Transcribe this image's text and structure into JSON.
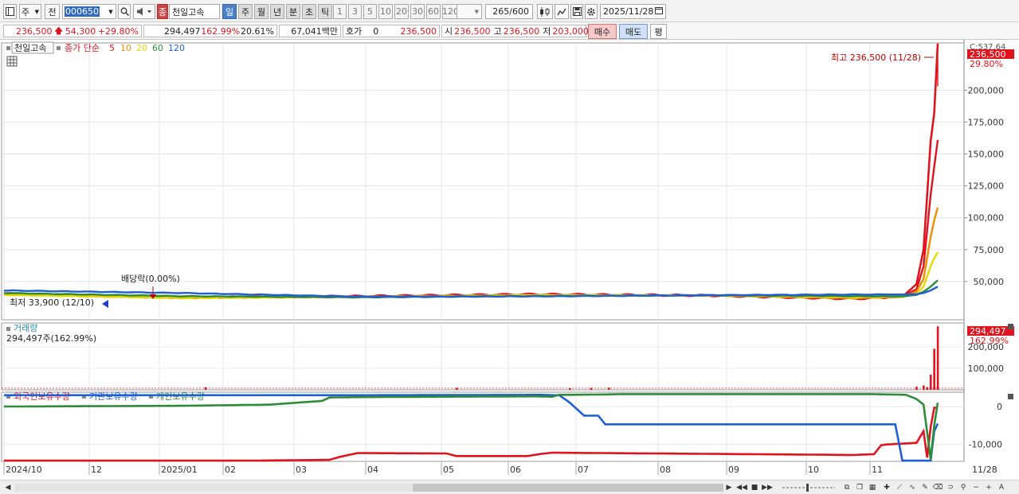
{
  "toolbar": {
    "period_select": "주",
    "prev_label": "전",
    "stock_code": "000650",
    "stock_type_badge": "종",
    "stock_name": "천일고속",
    "period_buttons": [
      "일",
      "주",
      "월",
      "년",
      "분",
      "초",
      "틱"
    ],
    "selected_period": "일",
    "minute_buttons": [
      "1",
      "3",
      "5",
      "10",
      "20",
      "30",
      "60",
      "120"
    ],
    "count_value": "265",
    "count_total": "/600",
    "date_value": "2025/11/28"
  },
  "info": {
    "price": "236,500",
    "change": "54,300",
    "change_pct": "+29.80%",
    "volume": "294,497",
    "volume_pct": "162.99%",
    "turnover": "20.61%",
    "amount": "67,041백만",
    "quote_label": "호가",
    "quote_value": "0",
    "ask_price": "236,500",
    "open_label": "시",
    "open": "236,500",
    "high_label": "고",
    "high": "236,500",
    "low_label": "저",
    "low": "203,000",
    "buy_label": "매수",
    "sell_label": "매도",
    "eval_label": "평"
  },
  "chart_data": [
    {
      "type": "line",
      "panel": "price",
      "legend_stock": "천일고속",
      "legend_items": [
        {
          "name": "종가 단순",
          "color": "#e0141e"
        },
        {
          "name": "5",
          "color": "#e0141e"
        },
        {
          "name": "10",
          "color": "#f08c00"
        },
        {
          "name": "20",
          "color": "#e6d800"
        },
        {
          "name": "60",
          "color": "#2e8b3a"
        },
        {
          "name": "120",
          "color": "#1f5fd6"
        }
      ],
      "x_ticks": [
        "2024/10",
        "12",
        "2025/01",
        "02",
        "03",
        "04",
        "05",
        "06",
        "07",
        "08",
        "09",
        "10",
        "11"
      ],
      "x_end_label": "11/28",
      "y_ticks": [
        50000,
        75000,
        100000,
        125000,
        150000,
        175000,
        200000
      ],
      "ylim": [
        20000,
        237000
      ],
      "grid": true,
      "current_price_tag": "236,500",
      "current_pct_tag": "29.80%",
      "top_right_label": "C:537.64",
      "annotations": {
        "high": "최고 236,500 (11/28)",
        "low": "최저 33,900 (12/10)",
        "dividend": "배당락(0.00%)"
      },
      "series": [
        {
          "name": "종가",
          "color": "#e0141e",
          "x": [
            0,
            50,
            100,
            150,
            200,
            240,
            254,
            258,
            260,
            262,
            263,
            264
          ],
          "values": [
            40500,
            37500,
            38500,
            40000,
            39000,
            36500,
            38000,
            48000,
            75000,
            160000,
            182000,
            236500
          ]
        },
        {
          "name": "5",
          "color": "#e0141e",
          "x": [
            0,
            50,
            100,
            150,
            200,
            240,
            254,
            258,
            260,
            262,
            263,
            264
          ],
          "values": [
            40000,
            37800,
            38300,
            39700,
            39000,
            36800,
            38000,
            44000,
            62000,
            118000,
            140000,
            161000
          ]
        },
        {
          "name": "10",
          "color": "#f08c00",
          "x": [
            0,
            50,
            100,
            150,
            200,
            240,
            254,
            258,
            260,
            262,
            263,
            264
          ],
          "values": [
            40000,
            38000,
            38200,
            39500,
            39000,
            37000,
            38000,
            42000,
            52000,
            85000,
            98000,
            108000
          ]
        },
        {
          "name": "20",
          "color": "#e6d800",
          "x": [
            0,
            50,
            100,
            150,
            200,
            240,
            254,
            258,
            260,
            262,
            263,
            264
          ],
          "values": [
            39500,
            37000,
            37900,
            39200,
            39200,
            37500,
            38000,
            40000,
            46000,
            62000,
            68000,
            73000
          ]
        },
        {
          "name": "60",
          "color": "#2e8b3a",
          "x": [
            0,
            50,
            100,
            150,
            200,
            240,
            254,
            258,
            260,
            262,
            263,
            264
          ],
          "values": [
            41000,
            38500,
            37600,
            38500,
            39200,
            38500,
            38300,
            39500,
            42000,
            46000,
            48500,
            51000
          ]
        },
        {
          "name": "120",
          "color": "#1f5fd6",
          "x": [
            0,
            50,
            100,
            150,
            200,
            240,
            254,
            258,
            260,
            262,
            263,
            264
          ],
          "values": [
            43000,
            41000,
            38200,
            38400,
            39300,
            39800,
            39800,
            40000,
            41000,
            43000,
            44500,
            46000
          ]
        }
      ]
    },
    {
      "type": "bar",
      "panel": "volume",
      "title": "거래량",
      "value_label": "294,497주(162.99%)",
      "current_tag": "294,497",
      "current_pct_tag": "162.99%",
      "y_ticks": [
        100000,
        200000
      ],
      "ylim": [
        0,
        310000
      ],
      "x": [
        57,
        128,
        160,
        166,
        171,
        258,
        260,
        261,
        262,
        263,
        264
      ],
      "values": [
        12000,
        9000,
        8000,
        9000,
        10000,
        14000,
        20000,
        12000,
        70000,
        190000,
        294497
      ],
      "color": "#e0141e"
    },
    {
      "type": "line",
      "panel": "holdings",
      "legend": [
        "외국인보유수량",
        "기관보유수량",
        "개인보유수량"
      ],
      "y_ticks": [
        0,
        -10000
      ],
      "ylim": [
        -14500,
        3800
      ],
      "grid": true,
      "series": [
        {
          "name": "외국인보유수량",
          "color": "#e0141e",
          "x": [
            0,
            25,
            46,
            70,
            92,
            95,
            100,
            125,
            128,
            148,
            152,
            155,
            240,
            246,
            248,
            250,
            256,
            258,
            260,
            261,
            262,
            263,
            264
          ],
          "values": [
            -14300,
            -14300,
            -14300,
            -14300,
            -14100,
            -13300,
            -12300,
            -12400,
            -13100,
            -13100,
            -12500,
            -12200,
            -12800,
            -12600,
            -10200,
            -10000,
            -9700,
            -9600,
            -6500,
            -13500,
            -5500,
            -300,
            -300
          ]
        },
        {
          "name": "기관보유수량",
          "color": "#1f5fd6",
          "x": [
            0,
            50,
            100,
            150,
            152,
            155,
            157,
            160,
            164,
            168,
            170,
            172,
            175,
            250,
            252,
            254,
            258,
            260,
            262,
            263,
            264
          ],
          "values": [
            3000,
            3000,
            3000,
            3100,
            3100,
            3000,
            3000,
            1000,
            -2400,
            -2400,
            -4700,
            -4700,
            -4700,
            -4700,
            -4700,
            -14300,
            -14300,
            -14300,
            -14300,
            -6500,
            -4500
          ]
        },
        {
          "name": "개인보유수량",
          "color": "#2e8b3a",
          "x": [
            0,
            50,
            75,
            90,
            92,
            100,
            125,
            150,
            155,
            157,
            160,
            170,
            175,
            200,
            245,
            255,
            258,
            260,
            262,
            263,
            264
          ],
          "values": [
            0,
            200,
            500,
            1500,
            2400,
            2500,
            2600,
            2700,
            2600,
            3100,
            3100,
            3200,
            3300,
            3300,
            3300,
            3100,
            2000,
            500,
            -14000,
            -5000,
            1000
          ]
        }
      ]
    }
  ]
}
